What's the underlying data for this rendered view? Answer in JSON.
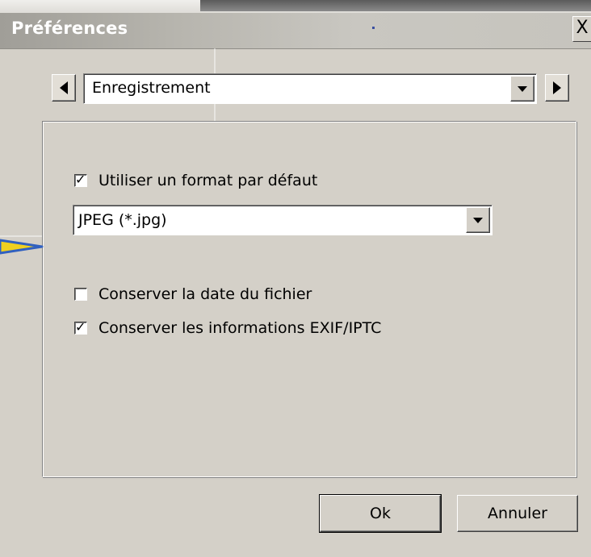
{
  "window": {
    "title": "Préférences",
    "close_glyph": "X"
  },
  "navigation": {
    "prev_icon": "triangle-left-icon",
    "next_icon": "triangle-right-icon",
    "section_selected": "Enregistrement"
  },
  "panel": {
    "use_default_format": {
      "label": "Utiliser un format par défaut",
      "checked": true
    },
    "format_select": {
      "value": "JPEG (*.jpg)"
    },
    "keep_file_date": {
      "label": "Conserver la date du fichier",
      "checked": false
    },
    "keep_exif": {
      "label": "Conserver les informations EXIF/IPTC",
      "checked": true
    }
  },
  "buttons": {
    "ok_label": "Ok",
    "cancel_label": "Annuler"
  },
  "colors": {
    "dialog_bg": "#d4d0c8",
    "pointer_stroke": "#3060c0",
    "pointer_fill": "#f0d020"
  }
}
